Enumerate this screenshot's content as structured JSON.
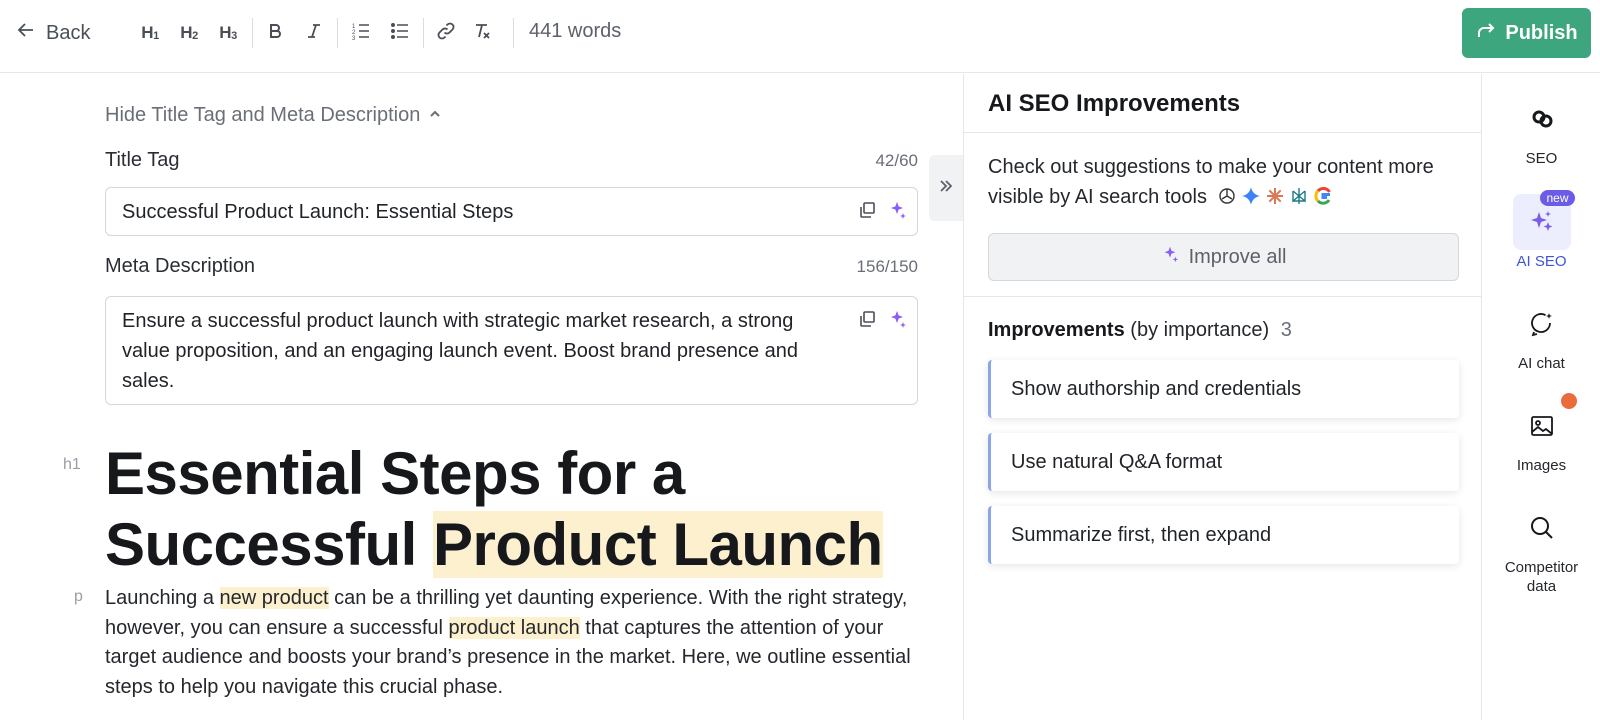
{
  "toolbar": {
    "back_label": "Back",
    "h1_label": "H",
    "h1_sub": "1",
    "h2_label": "H",
    "h2_sub": "2",
    "h3_label": "H",
    "h3_sub": "3",
    "word_count": "441 words",
    "publish_label": "Publish"
  },
  "meta": {
    "hide_toggle": "Hide Title Tag and Meta Description",
    "title_tag_label": "Title Tag",
    "title_tag_count": "42/60",
    "title_tag_value": "Successful Product Launch: Essential Steps",
    "meta_desc_label": "Meta Description",
    "meta_desc_count": "156/150",
    "meta_desc_value": "Ensure a successful product launch with strategic market research, a strong value proposition, and an engaging launch event. Boost brand presence and sales."
  },
  "content": {
    "h1_marker": "h1",
    "p_marker": "p",
    "heading_part1": "Essential Steps for a Successful ",
    "heading_highlight": "Product Launch",
    "para_1": "Launching a ",
    "para_hl_1": "new product",
    "para_2": " can be a thrilling yet daunting experience. With the right strategy, however, you can ensure a successful ",
    "para_hl_2": "product launch",
    "para_3": " that captures the attention of your target audience and boosts your brand’s presence in the market. Here, we outline essential steps to help you navigate this crucial phase."
  },
  "panel": {
    "title": "AI SEO Improvements",
    "description": "Check out suggestions to make your content more visible by AI search tools",
    "ai_tool_icons": [
      "openai-icon",
      "gemini-icon",
      "claude-icon",
      "perplexity-icon",
      "google-icon"
    ],
    "improve_all_label": "Improve all",
    "improvements_title": "Improvements",
    "improvements_subtitle": "(by importance)",
    "improvements_count": "3",
    "improvements": [
      {
        "label": "Show authorship and credentials"
      },
      {
        "label": "Use natural Q&A format"
      },
      {
        "label": "Summarize first, then expand"
      }
    ]
  },
  "rail": {
    "items": [
      {
        "label": "SEO",
        "icon": "seo-logo-icon"
      },
      {
        "label": "AI SEO",
        "icon": "sparkles-icon",
        "badge": "new",
        "active": true
      },
      {
        "label": "AI chat",
        "icon": "chat-sparkle-icon"
      },
      {
        "label": "Images",
        "icon": "image-icon",
        "notification": true
      },
      {
        "label": "Competitor data",
        "icon": "search-icon"
      }
    ]
  },
  "colors": {
    "publish_green": "#3ea67f",
    "highlight": "#fdf0cf",
    "active_blue": "#3d55d6",
    "new_badge": "#6b5ce7",
    "notification_dot": "#ea6c3c",
    "improvement_accent": "#8aa6e8"
  }
}
